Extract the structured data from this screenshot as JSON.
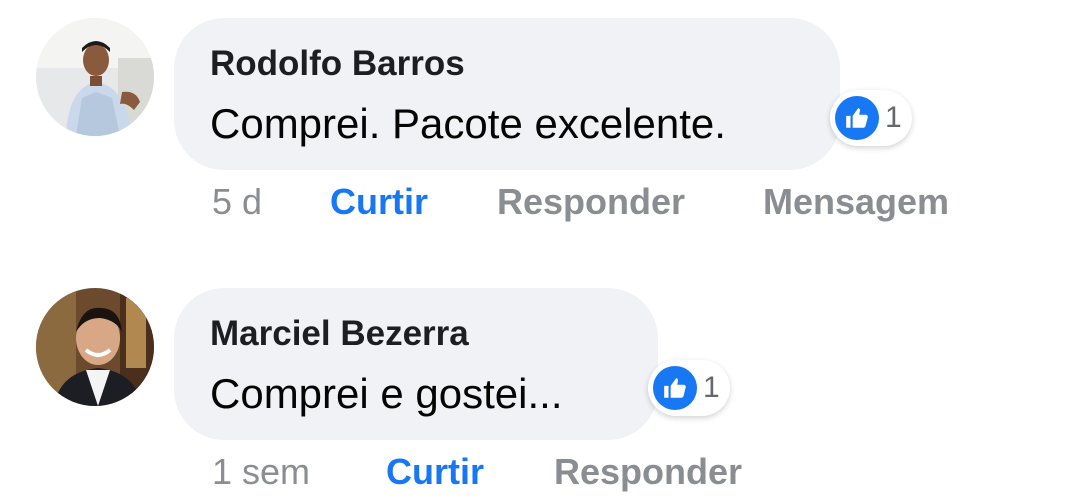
{
  "colors": {
    "accent": "#1877f2",
    "bubble": "#f0f2f5",
    "meta": "#8a8d91"
  },
  "comments": [
    {
      "author": "Rodolfo Barros",
      "text": "Comprei. Pacote excelente.",
      "reaction_icon": "like-icon",
      "reaction_count": "1",
      "time": "5 d",
      "like_label": "Curtir",
      "reply_label": "Responder",
      "message_label": "Mensagem"
    },
    {
      "author": "Marciel Bezerra",
      "text": "Comprei e gostei...",
      "reaction_icon": "like-icon",
      "reaction_count": "1",
      "time": "1 sem",
      "like_label": "Curtir",
      "reply_label": "Responder"
    }
  ]
}
